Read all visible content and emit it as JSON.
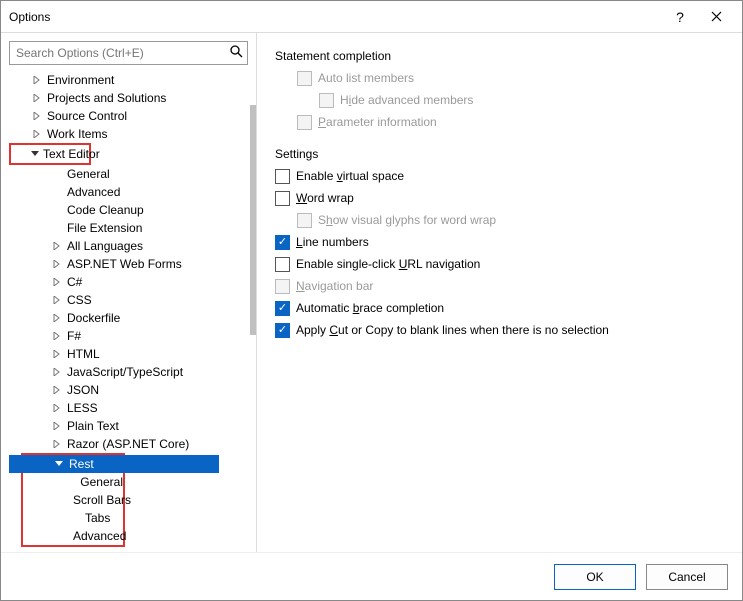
{
  "window": {
    "title": "Options"
  },
  "search": {
    "placeholder": "Search Options (Ctrl+E)"
  },
  "tree": {
    "environment": "Environment",
    "projects": "Projects and Solutions",
    "source_control": "Source Control",
    "work_items": "Work Items",
    "text_editor": "Text Editor",
    "te_general": "General",
    "te_advanced": "Advanced",
    "te_code_cleanup": "Code Cleanup",
    "te_file_ext": "File Extension",
    "te_all_lang": "All Languages",
    "te_asp_forms": "ASP.NET Web Forms",
    "te_csharp": "C#",
    "te_css": "CSS",
    "te_dockerfile": "Dockerfile",
    "te_fsharp": "F#",
    "te_html": "HTML",
    "te_jsts": "JavaScript/TypeScript",
    "te_json": "JSON",
    "te_less": "LESS",
    "te_plain": "Plain Text",
    "te_razor": "Razor (ASP.NET Core)",
    "te_rest": "Rest",
    "rest_general": "General",
    "rest_scroll": "Scroll Bars",
    "rest_tabs": "Tabs",
    "rest_advanced": "Advanced"
  },
  "panel": {
    "section1": "Statement completion",
    "auto_list": "Auto list members",
    "hide_adv_pre": "H",
    "hide_adv_u": "i",
    "hide_adv_post": "de advanced members",
    "param_pre": "",
    "param_u": "P",
    "param_post": "arameter information",
    "section2": "Settings",
    "virtual_pre": "Enable ",
    "virtual_u": "v",
    "virtual_post": "irtual space",
    "wrap_pre": "",
    "wrap_u": "W",
    "wrap_post": "ord wrap",
    "glyphs_pre": "S",
    "glyphs_u": "h",
    "glyphs_post": "ow visual glyphs for word wrap",
    "linenum_pre": "",
    "linenum_u": "L",
    "linenum_post": "ine numbers",
    "singleclick_pre": "Enable single-click ",
    "singleclick_u": "U",
    "singleclick_post": "RL navigation",
    "navbar_pre": "",
    "navbar_u": "N",
    "navbar_post": "avigation bar",
    "brace_pre": "Automatic ",
    "brace_u": "b",
    "brace_post": "race completion",
    "copy_pre": "Apply ",
    "copy_u": "C",
    "copy_post": "ut or Copy to blank lines when there is no selection"
  },
  "buttons": {
    "ok": "OK",
    "cancel": "Cancel"
  }
}
